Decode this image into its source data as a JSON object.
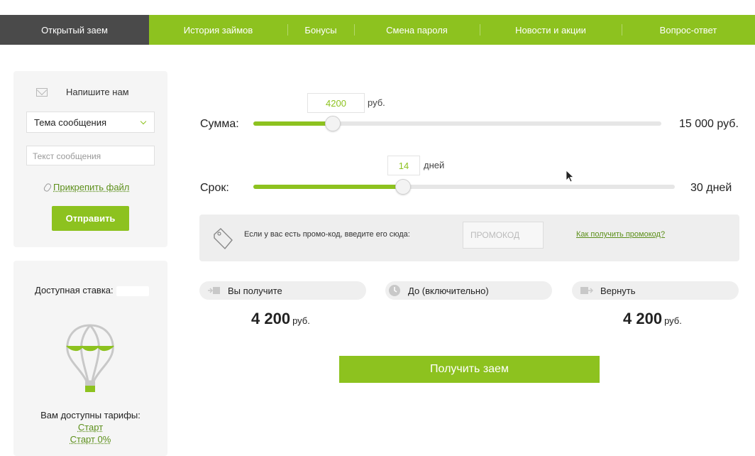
{
  "nav": {
    "items": [
      {
        "label": "Открытый заем",
        "active": true
      },
      {
        "label": "История займов",
        "active": false
      },
      {
        "label": "Бонусы",
        "active": false
      },
      {
        "label": "Смена пароля",
        "active": false
      },
      {
        "label": "Новости и акции",
        "active": false
      },
      {
        "label": "Вопрос-ответ",
        "active": false
      }
    ]
  },
  "contact": {
    "title": "Напишите нам",
    "icon": "envelope-icon",
    "subject_select": "Тема сообщения",
    "message_placeholder": "Текст сообщения",
    "attach_label": "Прикрепить файл",
    "send_label": "Отправить"
  },
  "rate_panel": {
    "rate_label": "Доступная ставка:",
    "tariffs_label": "Вам доступны тарифы:",
    "tariffs": [
      "Старт",
      "Старт 0%"
    ]
  },
  "amount_slider": {
    "label": "Сумма:",
    "value": "4200",
    "unit": "руб.",
    "max_label": "15 000 руб.",
    "fraction": 0.195
  },
  "term_slider": {
    "label": "Срок:",
    "value": "14",
    "unit": "дней",
    "max_label": "30 дней",
    "fraction": 0.355
  },
  "promo": {
    "text": "Если у вас есть промо-код, введите его сюда:",
    "placeholder": "ПРОМОКОД",
    "link": "Как получить промокод?"
  },
  "summary": {
    "receive_label": "Вы получите",
    "receive_amount": "4 200",
    "until_label": "До (включительно)",
    "return_label": "Вернуть",
    "return_amount": "4 200",
    "currency": "руб."
  },
  "cta_label": "Получить заем",
  "colors": {
    "accent": "#8dc21f",
    "nav_active": "#4a4a4a",
    "link": "#5c8f1a"
  }
}
